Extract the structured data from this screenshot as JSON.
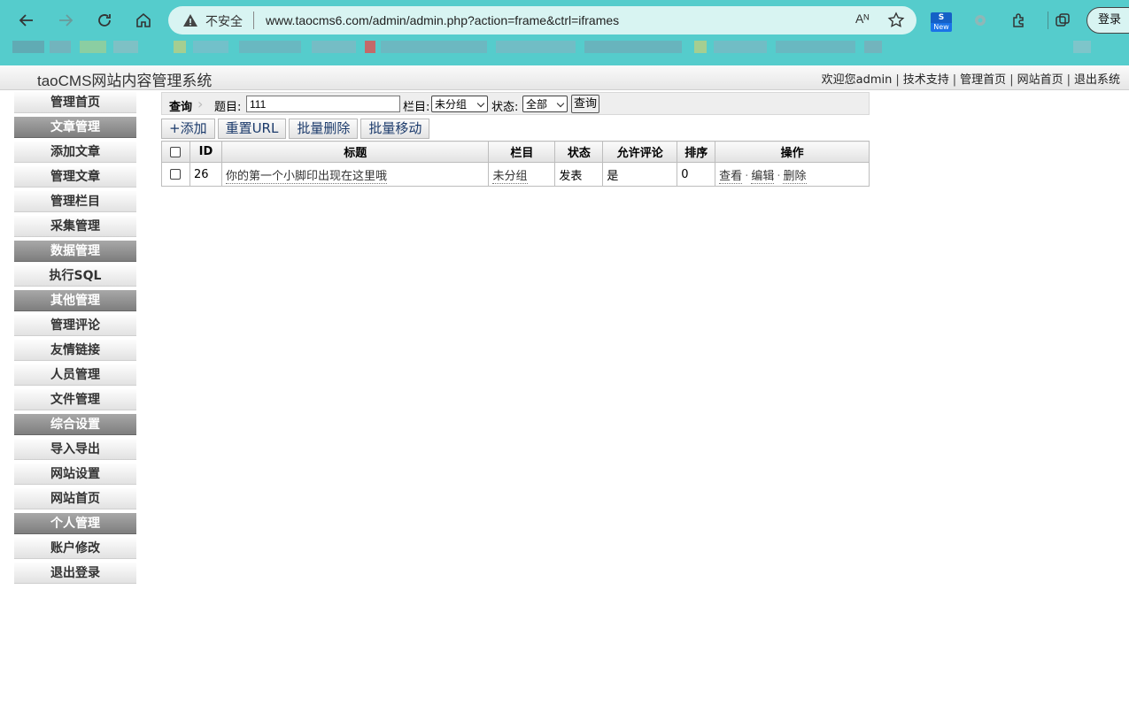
{
  "browser": {
    "insecure_label": "不安全",
    "url": "www.taocms6.com/admin/admin.php?action=frame&ctrl=iframes",
    "read_aloud": "Aᴺ",
    "new_badge": "New",
    "login_label": "登录",
    "colors": {
      "chrome": "#55cccc",
      "address_bar": "#d8f4f2"
    }
  },
  "header": {
    "title": "taoCMS网站内容管理系统",
    "welcome": "欢迎您admin",
    "links": [
      "技术支持",
      "管理首页",
      "网站首页",
      "退出系统"
    ]
  },
  "sidebar": {
    "items": [
      {
        "label": "管理首页",
        "group": false
      },
      {
        "label": "文章管理",
        "group": true
      },
      {
        "label": "添加文章",
        "group": false
      },
      {
        "label": "管理文章",
        "group": false
      },
      {
        "label": "管理栏目",
        "group": false
      },
      {
        "label": "采集管理",
        "group": false
      },
      {
        "label": "数据管理",
        "group": true
      },
      {
        "label": "执行SQL",
        "group": false
      },
      {
        "label": "其他管理",
        "group": true
      },
      {
        "label": "管理评论",
        "group": false
      },
      {
        "label": "友情链接",
        "group": false
      },
      {
        "label": "人员管理",
        "group": false
      },
      {
        "label": "文件管理",
        "group": false
      },
      {
        "label": "综合设置",
        "group": true
      },
      {
        "label": "导入导出",
        "group": false
      },
      {
        "label": "网站设置",
        "group": false
      },
      {
        "label": "网站首页",
        "group": false
      },
      {
        "label": "个人管理",
        "group": true
      },
      {
        "label": "账户修改",
        "group": false
      },
      {
        "label": "退出登录",
        "group": false
      }
    ]
  },
  "search": {
    "title": "查询",
    "keyword_label": "题目:",
    "keyword_value": "111",
    "column_label": "栏目:",
    "column_value": "未分组",
    "status_label": "状态:",
    "status_value": "全部",
    "submit_label": "查询"
  },
  "toolbar": {
    "add": "+添加",
    "reset_url": "重置URL",
    "batch_delete": "批量删除",
    "batch_move": "批量移动"
  },
  "table": {
    "headers": [
      "",
      "ID",
      "标题",
      "栏目",
      "状态",
      "允许评论",
      "排序",
      "操作"
    ],
    "rows": [
      {
        "id": "26",
        "title": "你的第一个小脚印出现在这里哦",
        "column": "未分组",
        "status": "发表",
        "allow_comment": "是",
        "order": "0",
        "ops": {
          "view": "查看",
          "sep": "·",
          "edit": "编辑",
          "delete": "删除"
        }
      }
    ]
  }
}
